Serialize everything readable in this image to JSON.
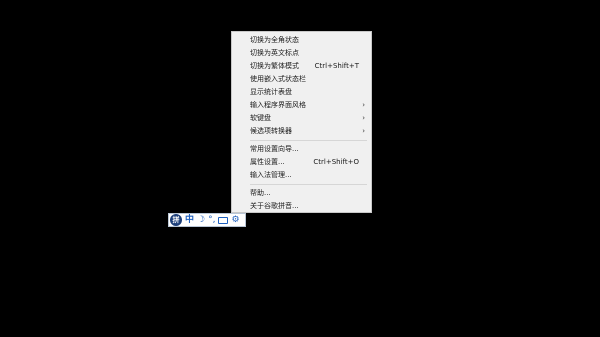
{
  "menu": {
    "group1": [
      {
        "label": "切换为全角状态",
        "shortcut": "",
        "submenu": false
      },
      {
        "label": "切换为英文标点",
        "shortcut": "",
        "submenu": false
      },
      {
        "label": "切换为繁体模式",
        "shortcut": "Ctrl+Shift+T",
        "submenu": false
      },
      {
        "label": "使用嵌入式状态栏",
        "shortcut": "",
        "submenu": false
      },
      {
        "label": "显示统计表盘",
        "shortcut": "",
        "submenu": false
      },
      {
        "label": "输入程序界面风格",
        "shortcut": "",
        "submenu": true
      },
      {
        "label": "软键盘",
        "shortcut": "",
        "submenu": true
      },
      {
        "label": "候选项转换器",
        "shortcut": "",
        "submenu": true
      }
    ],
    "group2": [
      {
        "label": "常用设置向导...",
        "shortcut": "",
        "submenu": false
      },
      {
        "label": "属性设置...",
        "shortcut": "Ctrl+Shift+O",
        "submenu": false
      },
      {
        "label": "输入法管理...",
        "shortcut": "",
        "submenu": false
      }
    ],
    "group3": [
      {
        "label": "帮助...",
        "shortcut": "",
        "submenu": false
      },
      {
        "label": "关于谷歌拼音...",
        "shortcut": "",
        "submenu": false
      }
    ],
    "submenu_arrow": "›"
  },
  "ime_bar": {
    "logo": "拼",
    "mode": "中",
    "shape": "☽",
    "punct": "°,",
    "settings": "⚙",
    "logo_color": "#1d3f7a",
    "accent_color": "#1d5fbf",
    "icons": [
      "google-pinyin-logo-icon",
      "chinese-mode-icon",
      "half-width-moon-icon",
      "punctuation-icon",
      "soft-keyboard-icon",
      "settings-gear-icon"
    ]
  }
}
